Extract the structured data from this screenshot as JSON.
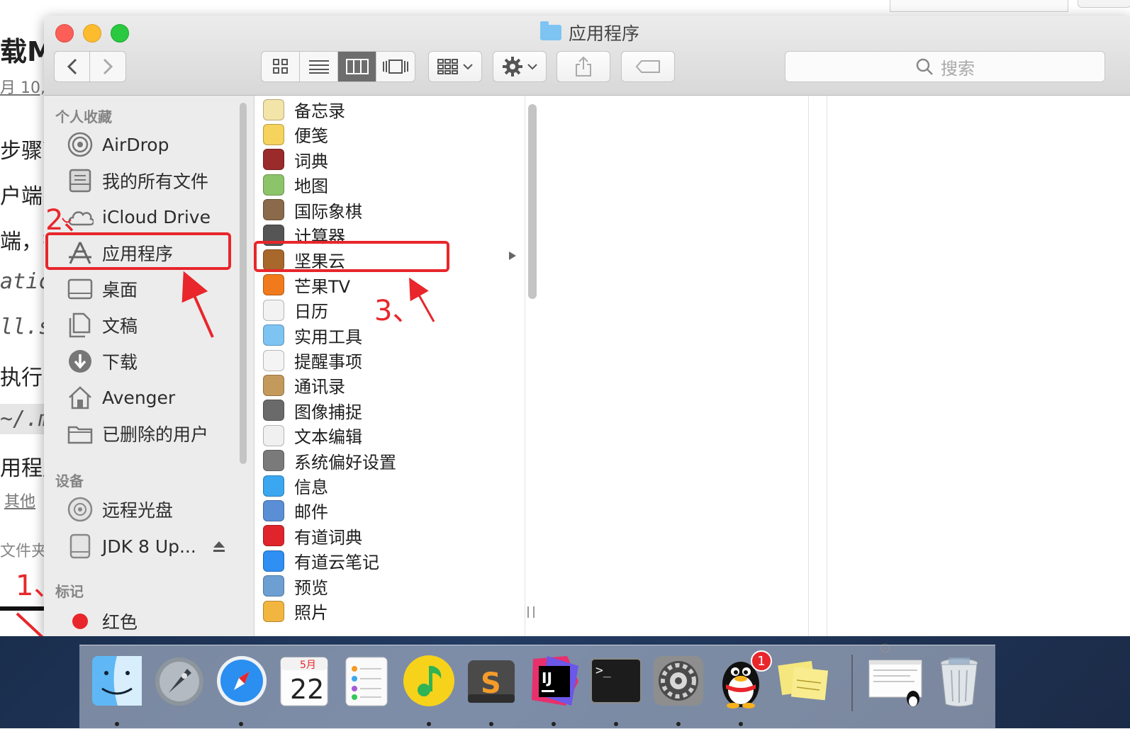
{
  "window": {
    "title": "应用程序",
    "search_placeholder": "搜索"
  },
  "toolbar": {
    "back_icon": "chevron-left-icon",
    "forward_icon": "chevron-right-icon",
    "view_modes": [
      "icon-view",
      "list-view",
      "column-view",
      "coverflow-view"
    ],
    "active_view": "column-view"
  },
  "sidebar": {
    "favorites_header": "个人收藏",
    "favorites": [
      {
        "label": "AirDrop",
        "icon": "airdrop-icon"
      },
      {
        "label": "我的所有文件",
        "icon": "all-files-icon"
      },
      {
        "label": "iCloud Drive",
        "icon": "cloud-icon"
      },
      {
        "label": "应用程序",
        "icon": "applications-icon"
      },
      {
        "label": "桌面",
        "icon": "desktop-icon"
      },
      {
        "label": "文稿",
        "icon": "documents-icon"
      },
      {
        "label": "下载",
        "icon": "download-icon"
      },
      {
        "label": "Avenger",
        "icon": "home-icon"
      },
      {
        "label": "已删除的用户",
        "icon": "folder-icon"
      }
    ],
    "devices_header": "设备",
    "devices": [
      {
        "label": "远程光盘",
        "icon": "disc-icon"
      },
      {
        "label": "JDK 8 Up...",
        "icon": "disk-icon"
      }
    ],
    "tags_header": "标记",
    "tags": [
      {
        "label": "红色",
        "color": "#e8262b"
      }
    ]
  },
  "apps": [
    {
      "label": "备忘录",
      "color": "#f3e5a7"
    },
    {
      "label": "便笺",
      "color": "#f5d35c"
    },
    {
      "label": "词典",
      "color": "#9b2a2a"
    },
    {
      "label": "地图",
      "color": "#8cc46a"
    },
    {
      "label": "国际象棋",
      "color": "#8a6a4a"
    },
    {
      "label": "计算器",
      "color": "#555555"
    },
    {
      "label": "坚果云",
      "color": "#a8672b"
    },
    {
      "label": "芒果TV",
      "color": "#f07a1c"
    },
    {
      "label": "日历",
      "color": "#f2f2f2"
    },
    {
      "label": "实用工具",
      "color": "#7ec4f3"
    },
    {
      "label": "提醒事项",
      "color": "#f4f4f4"
    },
    {
      "label": "通讯录",
      "color": "#c49a5c"
    },
    {
      "label": "图像捕捉",
      "color": "#6a6a6a"
    },
    {
      "label": "文本编辑",
      "color": "#f0f0f0"
    },
    {
      "label": "系统偏好设置",
      "color": "#7a7a7a"
    },
    {
      "label": "信息",
      "color": "#3aa7f0"
    },
    {
      "label": "邮件",
      "color": "#5a8fd6"
    },
    {
      "label": "有道词典",
      "color": "#e0242c"
    },
    {
      "label": "有道云笔记",
      "color": "#2f8ff2"
    },
    {
      "label": "预览",
      "color": "#6d9fd2"
    },
    {
      "label": "照片",
      "color": "#f2b640"
    }
  ],
  "annotations": {
    "step1": "1、",
    "step2": "2、",
    "step3": "3、",
    "color": "#e8262b"
  },
  "background_page": {
    "fragments": [
      "载M",
      "月 10,",
      "步骤可",
      "户端",
      "端，拉",
      "atic",
      "ll.s",
      "执行以",
      "~/.m",
      "用程序",
      "其他",
      "文件夹"
    ]
  },
  "dock": {
    "items": [
      {
        "name": "finder",
        "icon": "finder-icon"
      },
      {
        "name": "launchpad",
        "icon": "rocket-icon"
      },
      {
        "name": "safari",
        "icon": "compass-icon"
      },
      {
        "name": "calendar",
        "icon": "calendar-icon",
        "month": "5月",
        "day": "22"
      },
      {
        "name": "reminders",
        "icon": "reminders-icon"
      },
      {
        "name": "qq-music",
        "icon": "music-icon"
      },
      {
        "name": "sublime-text",
        "icon": "sublime-icon",
        "glyph": "S"
      },
      {
        "name": "intellij-idea",
        "icon": "idea-icon",
        "glyph": "IJ"
      },
      {
        "name": "terminal",
        "icon": "terminal-icon",
        "glyph": ">_"
      },
      {
        "name": "system-preferences",
        "icon": "gear-icon"
      },
      {
        "name": "qq",
        "icon": "penguin-icon",
        "badge": "1"
      },
      {
        "name": "stickies",
        "icon": "stickies-icon"
      },
      {
        "name": "recent-window",
        "icon": "window-thumbnail-icon"
      },
      {
        "name": "trash",
        "icon": "trash-icon"
      }
    ]
  }
}
